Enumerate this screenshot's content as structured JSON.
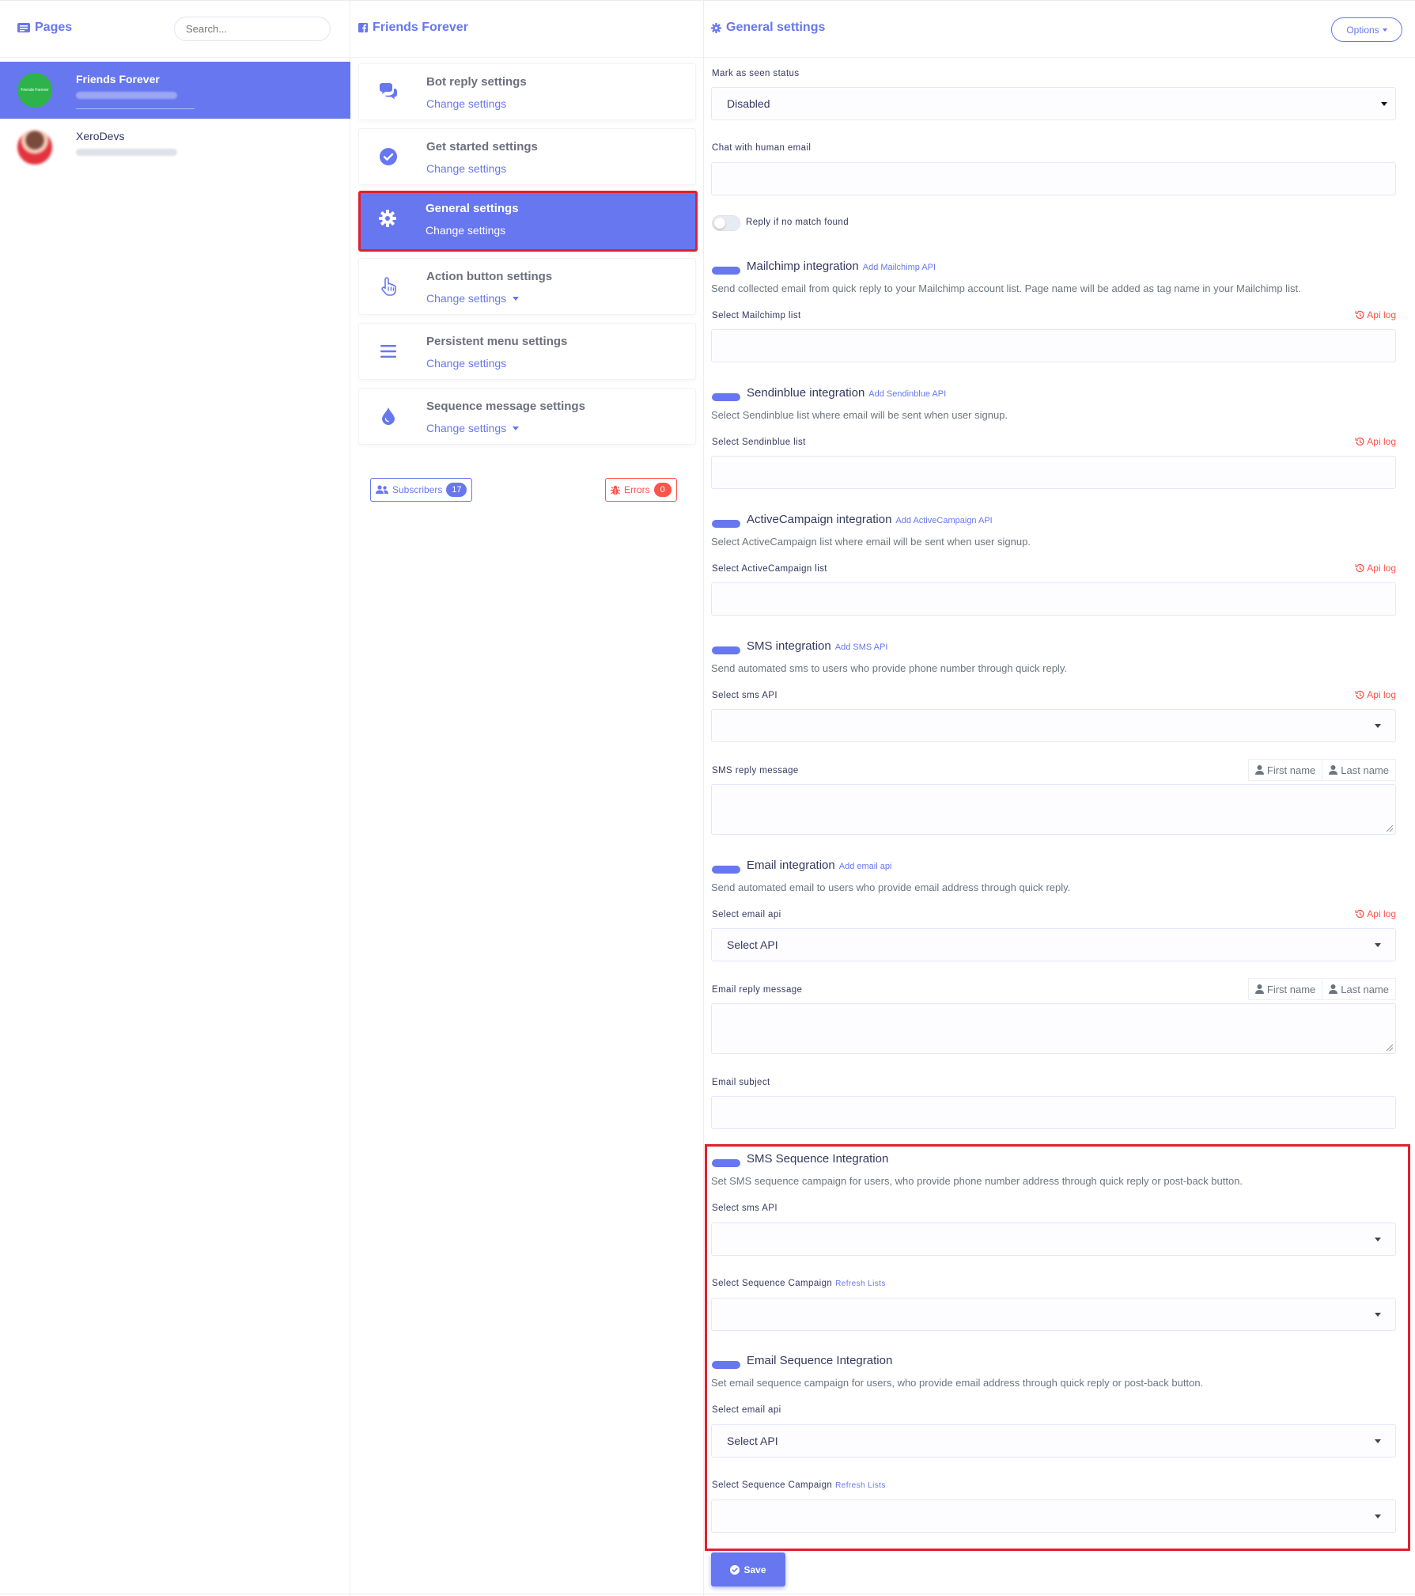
{
  "pages_panel": {
    "title": "Pages",
    "search_placeholder": "Search...",
    "items": [
      {
        "name": "Friends Forever",
        "avatar_text": "Friends Forever"
      },
      {
        "name": "XeroDevs"
      }
    ]
  },
  "settings_panel": {
    "title": "Friends Forever",
    "items": [
      {
        "title": "Bot reply settings",
        "sub": "Change settings"
      },
      {
        "title": "Get started settings",
        "sub": "Change settings"
      },
      {
        "title": "General settings",
        "sub": "Change settings"
      },
      {
        "title": "Action button settings",
        "sub": "Change settings"
      },
      {
        "title": "Persistent menu settings",
        "sub": "Change settings"
      },
      {
        "title": "Sequence message settings",
        "sub": "Change settings"
      }
    ],
    "subscribers_label": "Subscribers",
    "subscribers_count": "17",
    "errors_label": "Errors",
    "errors_count": "0"
  },
  "general": {
    "title": "General settings",
    "options_label": "Options",
    "mark_seen_label": "Mark as seen status",
    "mark_seen_value": "Disabled",
    "chat_human_label": "Chat with human email",
    "reply_no_match_label": "Reply if no match found",
    "api_log": "Api log",
    "first_name": "First name",
    "last_name": "Last name",
    "mailchimp": {
      "title": "Mailchimp integration",
      "add": "Add Mailchimp API",
      "desc": "Send collected email from quick reply to your Mailchimp account list. Page name will be added as tag name in your Mailchimp list.",
      "select_label": "Select Mailchimp list"
    },
    "sendinblue": {
      "title": "Sendinblue integration",
      "add": "Add Sendinblue API",
      "desc": "Select Sendinblue list where email will be sent when user signup.",
      "select_label": "Select Sendinblue list"
    },
    "activecampaign": {
      "title": "ActiveCampaign integration",
      "add": "Add ActiveCampaign API",
      "desc": "Select ActiveCampaign list where email will be sent when user signup.",
      "select_label": "Select ActiveCampaign list"
    },
    "sms": {
      "title": "SMS integration",
      "add": "Add SMS API",
      "desc": "Send automated sms to users who provide phone number through quick reply.",
      "select_label": "Select sms API",
      "reply_label": "SMS reply message"
    },
    "email": {
      "title": "Email integration",
      "add": "Add email api",
      "desc": "Send automated email to users who provide email address through quick reply.",
      "select_label": "Select email api",
      "select_value": "Select API",
      "reply_label": "Email reply message",
      "subject_label": "Email subject"
    },
    "sms_sequence": {
      "title": "SMS Sequence Integration",
      "desc": "Set SMS sequence campaign for users, who provide phone number address through quick reply or post-back button.",
      "select_label": "Select sms API",
      "campaign_label": "Select Sequence Campaign",
      "refresh": "Refresh Lists"
    },
    "email_sequence": {
      "title": "Email Sequence Integration",
      "desc": "Set email sequence campaign for users, who provide email address through quick reply or post-back button.",
      "select_label": "Select email api",
      "select_value": "Select API",
      "campaign_label": "Select Sequence Campaign",
      "refresh": "Refresh Lists"
    },
    "save_label": "Save"
  },
  "colors": {
    "accent": "#6777ef",
    "danger": "#fc544b",
    "highlight_frame": "#e0202e",
    "avatar_green": "#2db34a"
  }
}
